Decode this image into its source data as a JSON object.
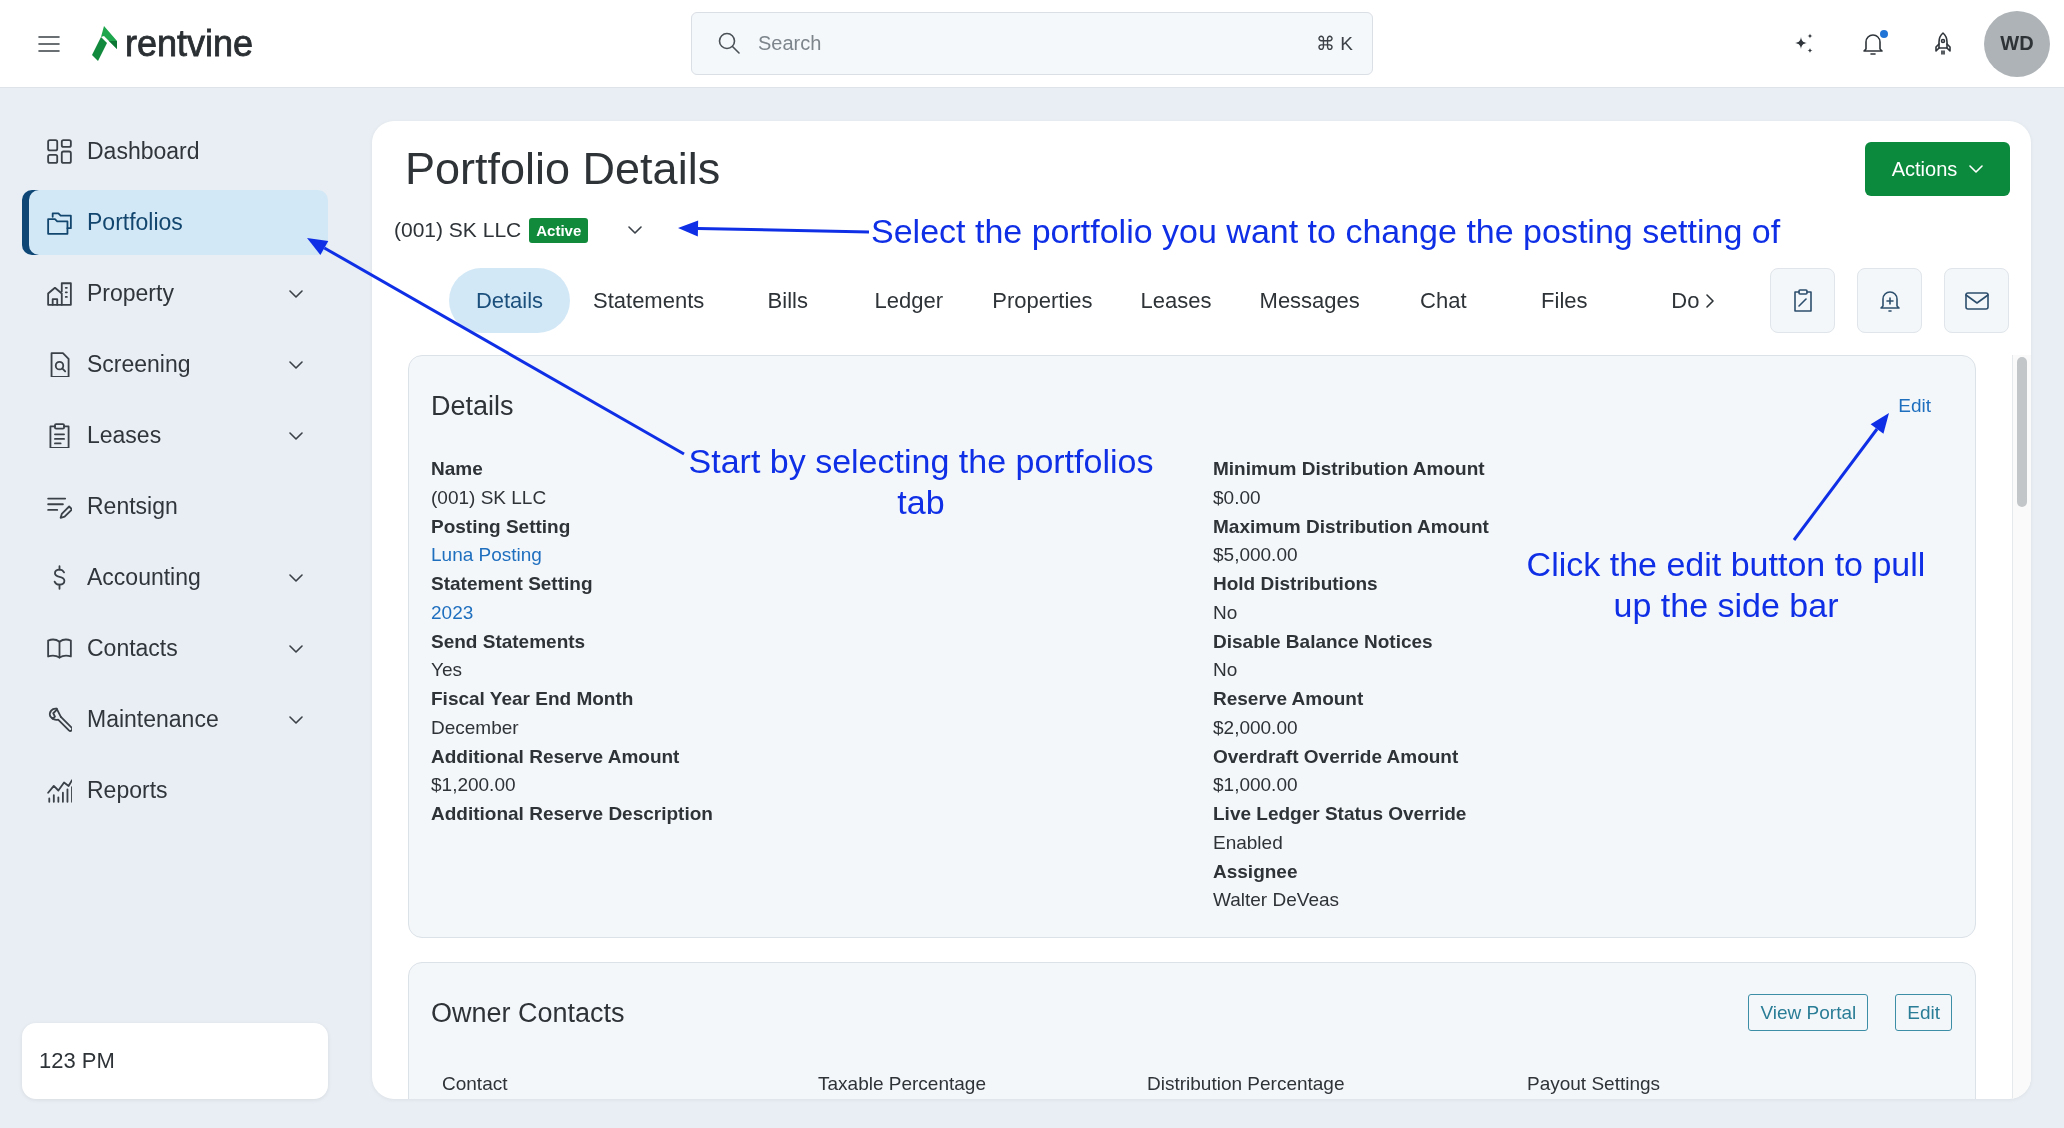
{
  "top_bar": {
    "logo": "rentvine",
    "search": {
      "placeholder": "Search",
      "shortcut": "⌘ K"
    },
    "notifications": {
      "unread": true
    },
    "avatar": "WD"
  },
  "sidebar": {
    "items": [
      {
        "label": "Dashboard",
        "kind": "link",
        "selected": false
      },
      {
        "label": "Portfolios",
        "kind": "link",
        "selected": true
      },
      {
        "label": "Property",
        "kind": "group",
        "selected": false
      },
      {
        "label": "Screening",
        "kind": "group",
        "selected": false
      },
      {
        "label": "Leases",
        "kind": "group",
        "selected": false
      },
      {
        "label": "Rentsign",
        "kind": "link",
        "selected": false
      },
      {
        "label": "Accounting",
        "kind": "group",
        "selected": false
      },
      {
        "label": "Contacts",
        "kind": "group",
        "selected": false
      },
      {
        "label": "Maintenance",
        "kind": "group",
        "selected": false
      },
      {
        "label": "Reports",
        "kind": "link",
        "selected": false
      }
    ],
    "footer": "123 PM"
  },
  "page": {
    "title": "Portfolio Details",
    "actions_button": "Actions",
    "portfolio": {
      "name": "(001) SK LLC",
      "status": "Active"
    },
    "tabs": [
      {
        "label": "Details",
        "selected": true
      },
      {
        "label": "Statements",
        "selected": false
      },
      {
        "label": "Bills",
        "selected": false
      },
      {
        "label": "Ledger",
        "selected": false
      },
      {
        "label": "Properties",
        "selected": false
      },
      {
        "label": "Leases",
        "selected": false
      },
      {
        "label": "Messages",
        "selected": false
      },
      {
        "label": "Chat",
        "selected": false
      },
      {
        "label": "Files",
        "selected": false
      },
      {
        "label": "Do",
        "selected": false
      }
    ],
    "details": {
      "title": "Details",
      "edit_link": "Edit",
      "columns": [
        [
          {
            "label": "Name",
            "value": "(001) SK LLC",
            "link": false
          },
          {
            "label": "Posting Setting",
            "value": "Luna Posting",
            "link": true
          },
          {
            "label": "Statement Setting",
            "value": "2023",
            "link": true
          },
          {
            "label": "Send Statements",
            "value": "Yes",
            "link": false
          },
          {
            "label": "Fiscal Year End Month",
            "value": "December",
            "link": false
          },
          {
            "label": "Additional Reserve Amount",
            "value": "$1,200.00",
            "link": false
          },
          {
            "label": "Additional Reserve Description"
          }
        ],
        [
          {
            "label": "Minimum Distribution Amount",
            "value": "$0.00",
            "link": false
          },
          {
            "label": "Maximum Distribution Amount",
            "value": "$5,000.00",
            "link": false
          },
          {
            "label": "Hold Distributions",
            "value": "No",
            "link": false
          },
          {
            "label": "Disable Balance Notices",
            "value": "No",
            "link": false
          },
          {
            "label": "Reserve Amount",
            "value": "$2,000.00",
            "link": false
          },
          {
            "label": "Overdraft Override Amount",
            "value": "$1,000.00",
            "link": false
          },
          {
            "label": "Live Ledger Status Override",
            "value": "Enabled",
            "link": false
          },
          {
            "label": "Assignee",
            "value": "Walter DeVeas",
            "link": false
          }
        ]
      ]
    },
    "owner_contacts": {
      "title": "Owner Contacts",
      "buttons": [
        "View Portal",
        "Edit"
      ],
      "table": {
        "columns": [
          "Contact",
          "Taxable Percentage",
          "Distribution Percentage",
          "Payout Settings"
        ]
      }
    }
  },
  "annotations": [
    {
      "text": "Select the portfolio you want to change the posting setting of"
    },
    {
      "text": "Start by selecting the portfolios tab"
    },
    {
      "text": "Click the edit button to pull up the side bar"
    }
  ]
}
